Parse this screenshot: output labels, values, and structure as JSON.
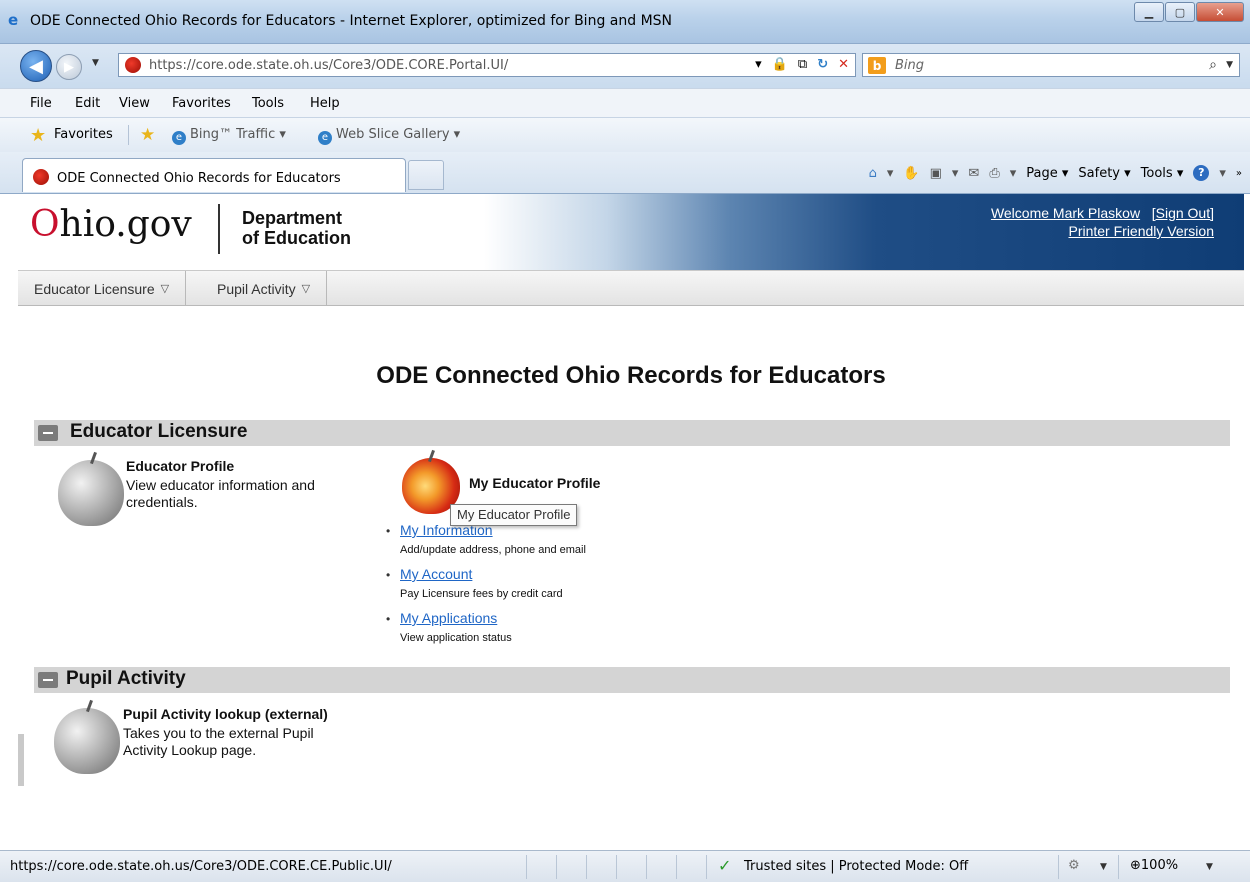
{
  "window": {
    "title": "ODE Connected Ohio Records for Educators - Internet Explorer, optimized for Bing and MSN"
  },
  "address_bar": {
    "url": "https://core.ode.state.oh.us/Core3/ODE.CORE.Portal.UI/",
    "search_placeholder": "Bing"
  },
  "menubar": {
    "items": [
      "File",
      "Edit",
      "View",
      "Favorites",
      "Tools",
      "Help"
    ]
  },
  "favorites_bar": {
    "favorites_label": "Favorites",
    "links": [
      "Bing™ Traffic ▾",
      "Web Slice Gallery ▾"
    ]
  },
  "tabs": {
    "active_label": "ODE Connected Ohio Records for Educators"
  },
  "command_bar": {
    "page": "Page ▾",
    "safety": "Safety ▾",
    "tools": "Tools ▾",
    "more": "»"
  },
  "site_header": {
    "logo_o": "O",
    "logo_rest": "hio.gov",
    "dept_line1": "Department",
    "dept_line2": "of Education",
    "welcome": "Welcome  Mark Plaskow",
    "sign_out": "[Sign Out]",
    "printer_friendly": "Printer Friendly Version"
  },
  "nav_menu": {
    "items": [
      "Educator Licensure",
      "Pupil Activity"
    ]
  },
  "main": {
    "title": "ODE Connected Ohio Records for Educators",
    "sections": [
      {
        "title": "Educator Licensure",
        "items": [
          {
            "title": "Educator Profile",
            "description": "View educator information and credentials."
          },
          {
            "title": "My Educator Profile",
            "tooltip": "My Educator Profile",
            "links": [
              {
                "label": "My Information",
                "sub": "Add/update address, phone and email"
              },
              {
                "label": "My Account",
                "sub": "Pay Licensure fees by credit card"
              },
              {
                "label": "My Applications",
                "sub": "View application status"
              }
            ]
          }
        ]
      },
      {
        "title": "Pupil Activity",
        "items": [
          {
            "title": "Pupil Activity lookup (external)",
            "description": "Takes you to the external Pupil Activity Lookup page."
          }
        ]
      }
    ]
  },
  "status_bar": {
    "url": "https://core.ode.state.oh.us/Core3/ODE.CORE.CE.Public.UI/",
    "zone": "Trusted sites | Protected Mode: Off",
    "zoom": "100%"
  },
  "colors": {
    "brand_red": "#c8102e",
    "header_blue": "#0f3d75",
    "link_blue": "#1f66c6",
    "section_gray": "#d4d4d4"
  }
}
